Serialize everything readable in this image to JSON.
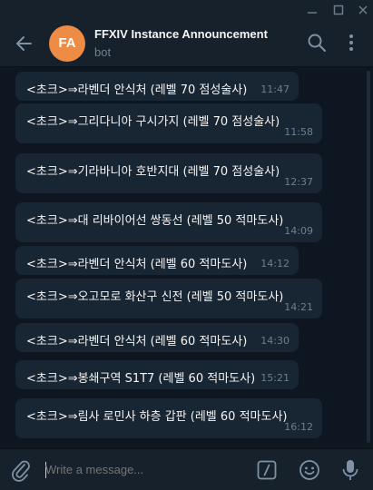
{
  "window": {
    "controls": [
      "minimize-icon",
      "maximize-icon",
      "close-icon"
    ]
  },
  "header": {
    "avatar_initials": "FA",
    "avatar_color": "#ee8b44",
    "title": "FFXIV Instance Announcement",
    "status": "bot"
  },
  "messages": [
    {
      "text": "<초크>⇒라벤더 안식처 (레벨 70 점성술사)",
      "time": "11:47"
    },
    {
      "text": "<초크>⇒그리다니아 구시가지 (레벨 70 점성술사)",
      "time": "11:58"
    },
    {
      "text": "<초크>⇒기라바니아 호반지대 (레벨 70 점성술사)",
      "time": "12:37"
    },
    {
      "text": "<초크>⇒대 리바이어선 쌍동선 (레벨 50 적마도사)",
      "time": "14:09"
    },
    {
      "text": "<초크>⇒라벤더 안식처 (레벨 60 적마도사)",
      "time": "14:12"
    },
    {
      "text": "<초크>⇒오고모로 화산구 신전 (레벨 50 적마도사)",
      "time": "14:21"
    },
    {
      "text": "<초크>⇒라벤더 안식처 (레벨 60 적마도사)",
      "time": "14:30"
    },
    {
      "text": "<초크>⇒봉쇄구역 S1T7 (레벨 60 적마도사)",
      "time": "15:21"
    },
    {
      "text": "<초크>⇒림사 로민사 하층 갑판 (레벨 60 적마도사)",
      "time": "16:12"
    }
  ],
  "composer": {
    "placeholder": "Write a message..."
  },
  "colors": {
    "background": "#0e1621",
    "panel": "#17212b",
    "bubble": "#182533",
    "muted": "#6d7f8f"
  }
}
